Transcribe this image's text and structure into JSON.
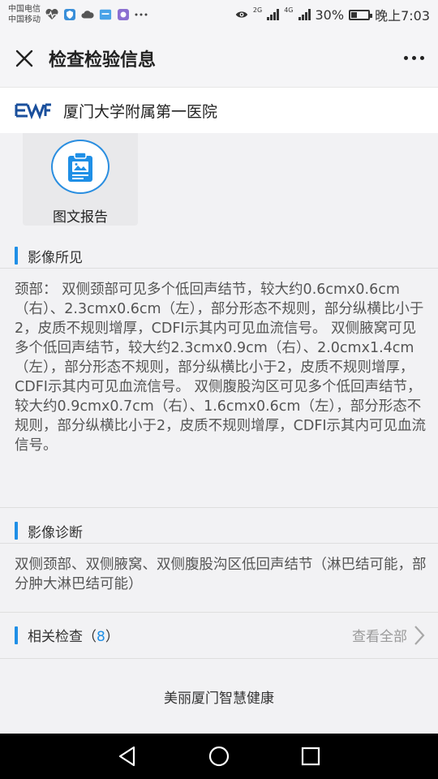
{
  "status_bar": {
    "carrier_1": "中国电信",
    "carrier_2": "中国移动",
    "network_1": "2G",
    "network_2": "4G",
    "battery": "30%",
    "time": "晚上7:03",
    "icons": [
      "heart-rate-icon",
      "shield-icon",
      "cloud-icon",
      "app-icon",
      "app2-icon",
      "more-notifications-icon",
      "eye-icon",
      "signal-icon",
      "battery-icon"
    ]
  },
  "titlebar": {
    "title": "检查检验信息",
    "close_icon": "close-icon",
    "more_icon": "more-icon"
  },
  "hospital": {
    "name": "厦门大学附属第一医院",
    "logo_text": "EWF"
  },
  "report_tile": {
    "label": "图文报告",
    "icon": "report-icon"
  },
  "findings": {
    "title": "影像所见",
    "text": "颈部： 双侧颈部可见多个低回声结节，较大约0.6cmx0.6cm（右）、2.3cmx0.6cm（左），部分形态不规则，部分纵横比小于2，皮质不规则增厚，CDFI示其内可见血流信号。 双侧腋窝可见多个低回声结节，较大约2.3cmx0.9cm（右）、2.0cmx1.4cm（左），部分形态不规则，部分纵横比小于2，皮质不规则增厚，CDFI示其内可见血流信号。 双侧腹股沟区可见多个低回声结节，较大约0.9cmx0.7cm（右）、1.6cmx0.6cm（左），部分形态不规则，部分纵横比小于2，皮质不规则增厚，CDFI示其内可见血流信号。"
  },
  "diagnosis": {
    "title": "影像诊断",
    "text": "双侧颈部、双侧腋窝、双侧腹股沟区低回声结节（淋巴结可能，部分肿大淋巴结可能）"
  },
  "related": {
    "title": "相关检查（",
    "count": "8",
    "title_end": "）",
    "view_all": "查看全部"
  },
  "footer": {
    "text": "美丽厦门智慧健康"
  },
  "colors": {
    "accent": "#1f8fe6",
    "background": "#f2f2f4",
    "navbar": "#000000"
  }
}
